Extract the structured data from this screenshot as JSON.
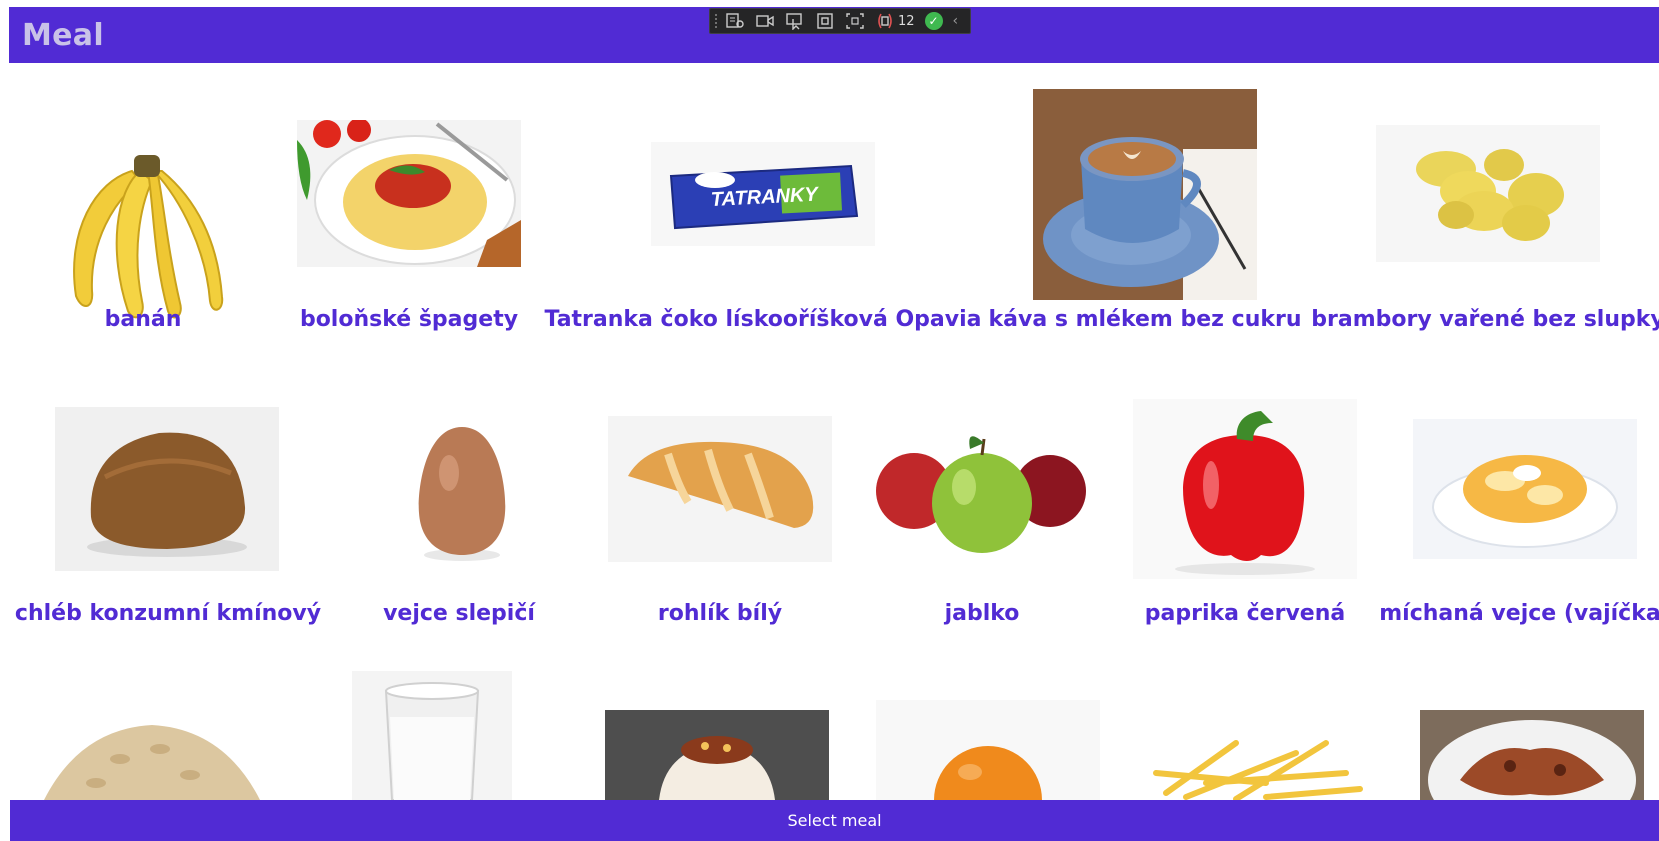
{
  "header": {
    "title": "Meal"
  },
  "debug_toolbar": {
    "error_count": "12"
  },
  "meals": [
    {
      "name": "banán",
      "icon": "banana-image"
    },
    {
      "name": "boloňské špagety",
      "icon": "spaghetti-image"
    },
    {
      "name": "Tatranka čoko lískooříšková Opavia",
      "icon": "wafer-bar-image"
    },
    {
      "name": "káva s mlékem bez cukru",
      "icon": "coffee-image"
    },
    {
      "name": "brambory vařené bez slupky",
      "icon": "potatoes-image"
    },
    {
      "name": "chléb konzumní kmínový",
      "icon": "bread-image"
    },
    {
      "name": "vejce slepičí",
      "icon": "egg-image"
    },
    {
      "name": "rohlík bílý",
      "icon": "roll-image"
    },
    {
      "name": "jablko",
      "icon": "apples-image"
    },
    {
      "name": "paprika červená",
      "icon": "pepper-image"
    },
    {
      "name": "míchaná vejce (vajíčka)",
      "icon": "scrambled-eggs-image"
    },
    {
      "name": "",
      "icon": "oat-flakes-image"
    },
    {
      "name": "",
      "icon": "milk-glass-image"
    },
    {
      "name": "",
      "icon": "dessert-image"
    },
    {
      "name": "",
      "icon": "orange-image"
    },
    {
      "name": "",
      "icon": "fries-image"
    },
    {
      "name": "",
      "icon": "grilled-meat-image"
    }
  ],
  "footer": {
    "select_label": "Select meal"
  },
  "colors": {
    "accent": "#512bd4",
    "header_title": "#c9c2e8"
  }
}
